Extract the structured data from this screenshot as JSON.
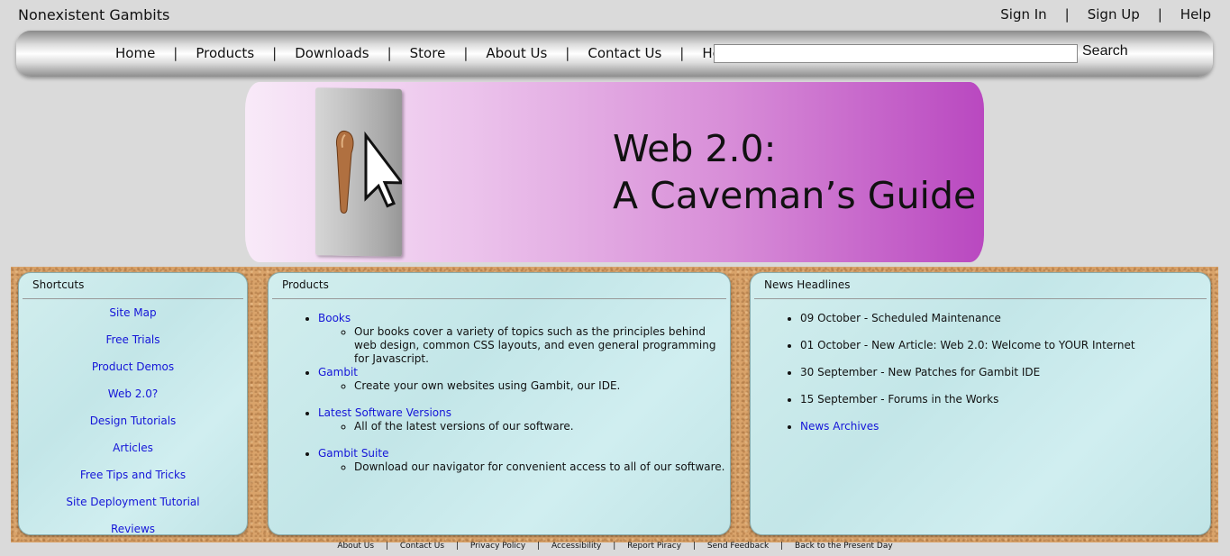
{
  "site": {
    "title": "Nonexistent Gambits"
  },
  "account": {
    "sign_in": "Sign In",
    "sign_up": "Sign Up",
    "help": "Help",
    "separator": "|"
  },
  "nav": {
    "items": [
      "Home",
      "Products",
      "Downloads",
      "Store",
      "About Us",
      "Contact Us",
      "Help"
    ],
    "separator": "|",
    "search_value": "",
    "search_button": "Search"
  },
  "banner": {
    "title_line1": "Web 2.0:",
    "title_line2": "A Caveman’s Guide"
  },
  "shortcuts": {
    "heading": "Shortcuts",
    "items": [
      "Site Map",
      "Free Trials",
      "Product Demos",
      "Web 2.0?",
      "Design Tutorials",
      "Articles",
      "Free Tips and Tricks",
      "Site Deployment Tutorial",
      "Reviews"
    ]
  },
  "products": {
    "heading": "Products",
    "items": [
      {
        "name": "Books",
        "desc": "Our books cover a variety of topics such as the principles behind web design, common CSS layouts, and even general programming for Javascript."
      },
      {
        "name": "Gambit",
        "desc": "Create your own websites using Gambit, our IDE."
      },
      {
        "name": "Latest Software Versions",
        "desc": "All of the latest versions of our software."
      },
      {
        "name": "Gambit Suite",
        "desc": "Download our navigator for convenient access to all of our software."
      }
    ]
  },
  "news": {
    "heading": "News Headlines",
    "items": [
      "09 October - Scheduled Maintenance",
      "01 October - New Article: Web 2.0: Welcome to YOUR Internet",
      "30 September - New Patches for Gambit IDE",
      "15 September - Forums in the Works"
    ],
    "archive_link": "News Archives"
  },
  "footer": {
    "links": [
      "About Us",
      "Contact Us",
      "Privacy Policy",
      "Accessibility",
      "Report Piracy",
      "Send Feedback",
      "Back to the Present Day"
    ],
    "separator": "|"
  },
  "colors": {
    "link": "#1515d8",
    "banner_end": "#b948c0",
    "panel_bg": "#c8eaea",
    "cork": "#d9a36a"
  }
}
